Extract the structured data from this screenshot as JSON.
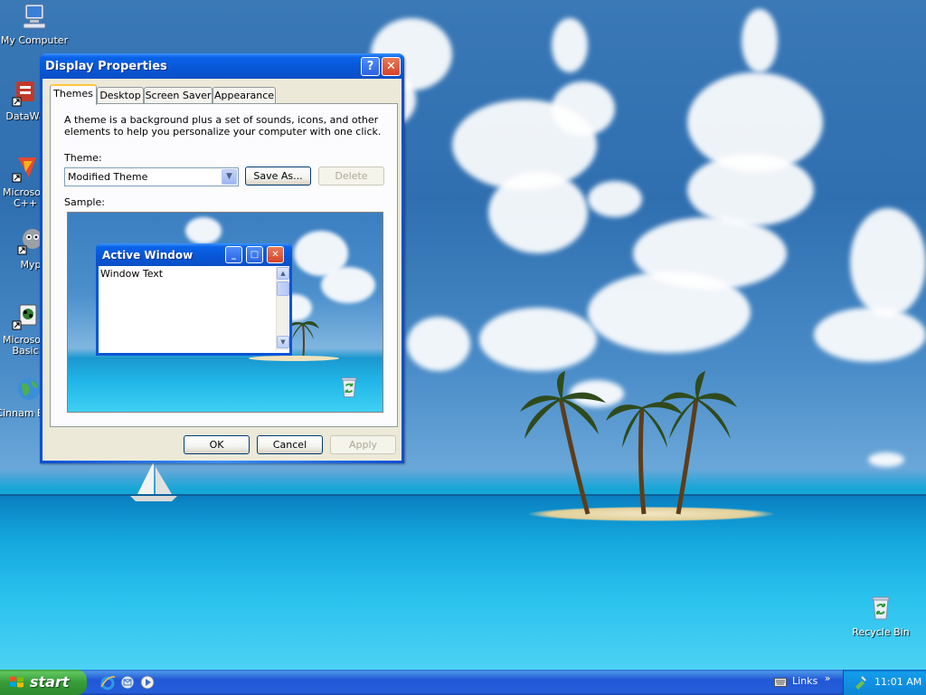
{
  "desktop": {
    "icons": [
      {
        "label": "My Computer",
        "icon": "computer-icon"
      },
      {
        "label": "DataWa",
        "icon": "datawa-shortcut-icon"
      },
      {
        "label": "Microsoft C++",
        "icon": "visual-cpp-icon"
      },
      {
        "label": "Myp",
        "icon": "myp-shortcut-icon"
      },
      {
        "label": "Microsoft Basic",
        "icon": "visual-basic-icon"
      },
      {
        "label": "Cinnam Brow",
        "icon": "globe-icon"
      },
      {
        "label": "Recycle Bin",
        "icon": "recycle-bin-icon"
      }
    ]
  },
  "dialog": {
    "title": "Display Properties",
    "help_glyph": "?",
    "close_glyph": "✕",
    "tabs": [
      {
        "label": "Themes",
        "active": true
      },
      {
        "label": "Desktop",
        "active": false
      },
      {
        "label": "Screen Saver",
        "active": false
      },
      {
        "label": "Appearance",
        "active": false
      }
    ],
    "description": "A theme is a background plus a set of sounds, icons, and other elements to help you personalize your computer with one click.",
    "theme_label": "Theme:",
    "theme_value": "Modified Theme",
    "save_as_label": "Save As...",
    "delete_label": "Delete",
    "sample_label": "Sample:",
    "sample": {
      "window_title": "Active Window",
      "window_text": "Window Text"
    },
    "ok_label": "OK",
    "cancel_label": "Cancel",
    "apply_label": "Apply"
  },
  "taskbar": {
    "start_label": "start",
    "links_label": "Links",
    "chevron": "»",
    "clock": "11:01 AM"
  },
  "colors": {
    "titlebar_blue": "#0856d6",
    "start_green": "#379c37",
    "dialog_face": "#ece9d8"
  }
}
